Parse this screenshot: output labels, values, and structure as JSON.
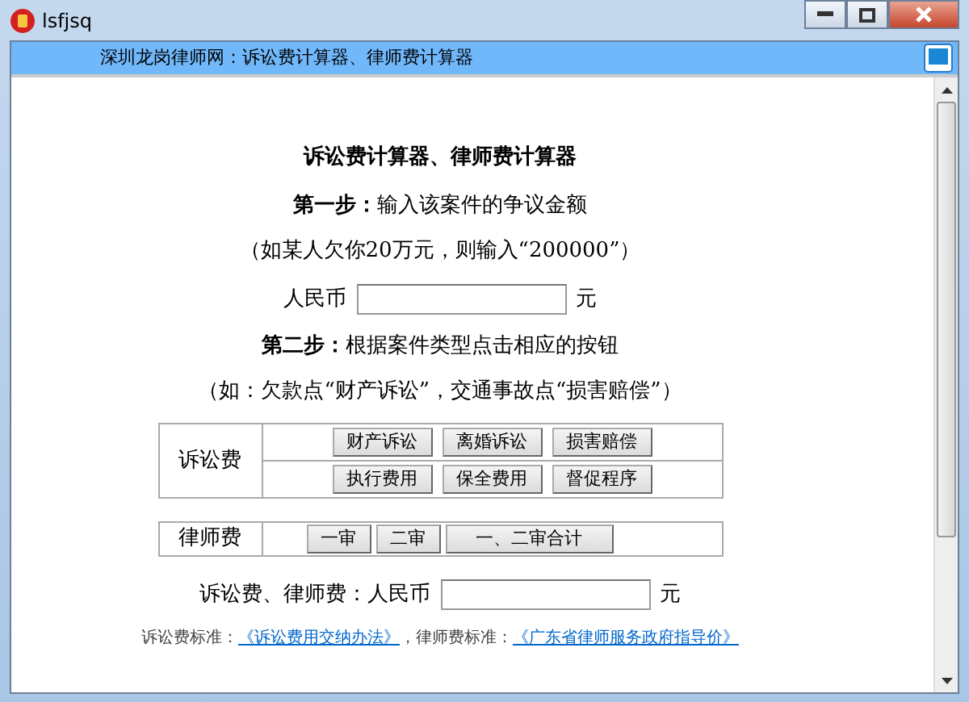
{
  "window": {
    "title": "lsfjsq"
  },
  "header": {
    "title": "深圳龙岗律师网：诉讼费计算器、律师费计算器"
  },
  "content": {
    "heading": "诉讼费计算器、律师费计算器",
    "step1": {
      "label": "第一步：",
      "text": "输入该案件的争议金额"
    },
    "example1": "（如某人欠你20万元，则输入“200000”）",
    "amount": {
      "label": "人民币",
      "unit": "元"
    },
    "step2": {
      "label": "第二步：",
      "text": "根据案件类型点击相应的按钮"
    },
    "example2": "（如：欠款点“财产诉讼”，交通事故点“损害赔偿”）",
    "litigation": {
      "label": "诉讼费",
      "button_rows": [
        [
          "财产诉讼",
          "离婚诉讼",
          "损害赔偿"
        ],
        [
          "执行费用",
          "保全费用",
          "督促程序"
        ]
      ]
    },
    "lawyer": {
      "label": "律师费",
      "buttons": [
        {
          "label": "一审",
          "wide": false
        },
        {
          "label": "二审",
          "wide": false
        },
        {
          "label": "一、二审合计",
          "wide": true
        }
      ]
    },
    "result": {
      "label": "诉讼费、律师费：人民币",
      "unit": "元"
    },
    "footer": [
      {
        "text": "诉讼费标准：",
        "link": false
      },
      {
        "text": "《诉讼费用交纳办法》",
        "link": true
      },
      {
        "text": "，律师费标准：",
        "link": false
      },
      {
        "text": "《广东省律师服务政府指导价》",
        "link": true
      }
    ]
  }
}
